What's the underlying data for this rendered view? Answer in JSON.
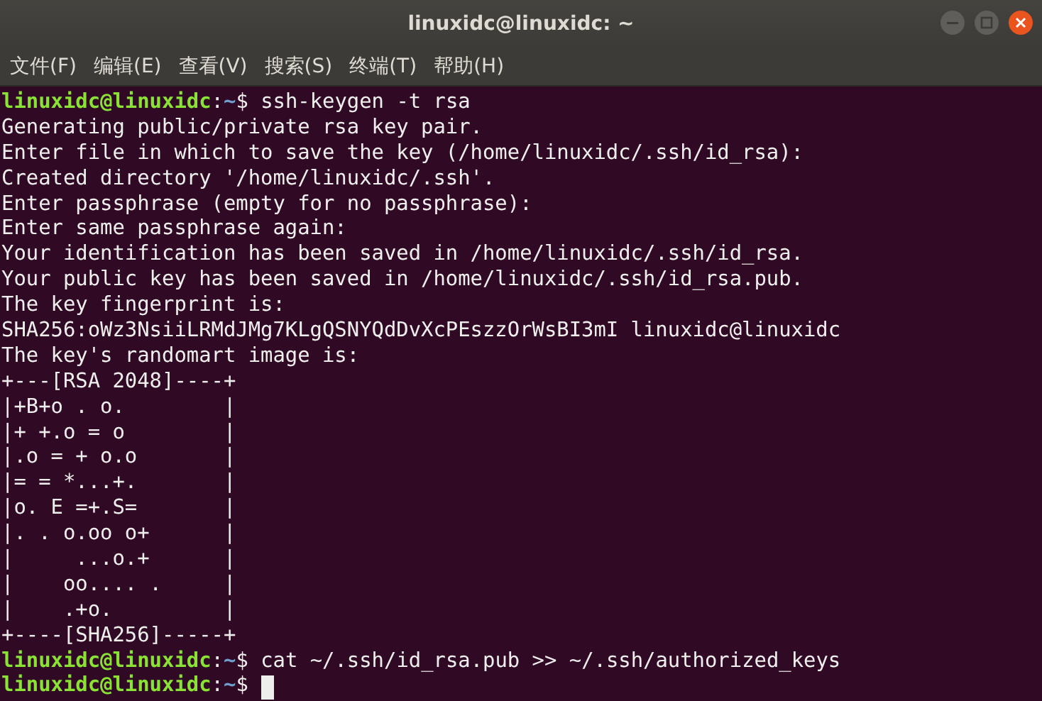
{
  "window": {
    "title": "linuxidc@linuxidc: ~"
  },
  "menu": [
    {
      "label": "文件(F)"
    },
    {
      "label": "编辑(E)"
    },
    {
      "label": "查看(V)"
    },
    {
      "label": "搜索(S)"
    },
    {
      "label": "终端(T)"
    },
    {
      "label": "帮助(H)"
    }
  ],
  "terminal": {
    "lines": [
      {
        "kind": "prompt",
        "user": "linuxidc@linuxidc",
        "separator": ":",
        "path": "~",
        "symbol": "$",
        "command": "ssh-keygen -t rsa"
      },
      {
        "kind": "output",
        "text": "Generating public/private rsa key pair."
      },
      {
        "kind": "output",
        "text": "Enter file in which to save the key (/home/linuxidc/.ssh/id_rsa):"
      },
      {
        "kind": "output",
        "text": "Created directory '/home/linuxidc/.ssh'."
      },
      {
        "kind": "output",
        "text": "Enter passphrase (empty for no passphrase):"
      },
      {
        "kind": "output",
        "text": "Enter same passphrase again:"
      },
      {
        "kind": "output",
        "text": "Your identification has been saved in /home/linuxidc/.ssh/id_rsa."
      },
      {
        "kind": "output",
        "text": "Your public key has been saved in /home/linuxidc/.ssh/id_rsa.pub."
      },
      {
        "kind": "output",
        "text": "The key fingerprint is:"
      },
      {
        "kind": "output",
        "text": "SHA256:oWz3NsiiLRMdJMg7KLgQSNYQdDvXcPEszzOrWsBI3mI linuxidc@linuxidc"
      },
      {
        "kind": "output",
        "text": "The key's randomart image is:"
      },
      {
        "kind": "output",
        "text": "+---[RSA 2048]----+"
      },
      {
        "kind": "output",
        "text": "|+B+o . o.        |"
      },
      {
        "kind": "output",
        "text": "|+ +.o = o        |"
      },
      {
        "kind": "output",
        "text": "|.o = + o.o       |"
      },
      {
        "kind": "output",
        "text": "|= = *...+.       |"
      },
      {
        "kind": "output",
        "text": "|o. E =+.S=       |"
      },
      {
        "kind": "output",
        "text": "|. . o.oo o+      |"
      },
      {
        "kind": "output",
        "text": "|     ...o.+      |"
      },
      {
        "kind": "output",
        "text": "|    oo.... .     |"
      },
      {
        "kind": "output",
        "text": "|    .+o.         |"
      },
      {
        "kind": "output",
        "text": "+----[SHA256]-----+"
      },
      {
        "kind": "prompt",
        "user": "linuxidc@linuxidc",
        "separator": ":",
        "path": "~",
        "symbol": "$",
        "command": "cat ~/.ssh/id_rsa.pub >> ~/.ssh/authorized_keys"
      },
      {
        "kind": "prompt",
        "user": "linuxidc@linuxidc",
        "separator": ":",
        "path": "~",
        "symbol": "$",
        "cursor": true
      }
    ]
  }
}
